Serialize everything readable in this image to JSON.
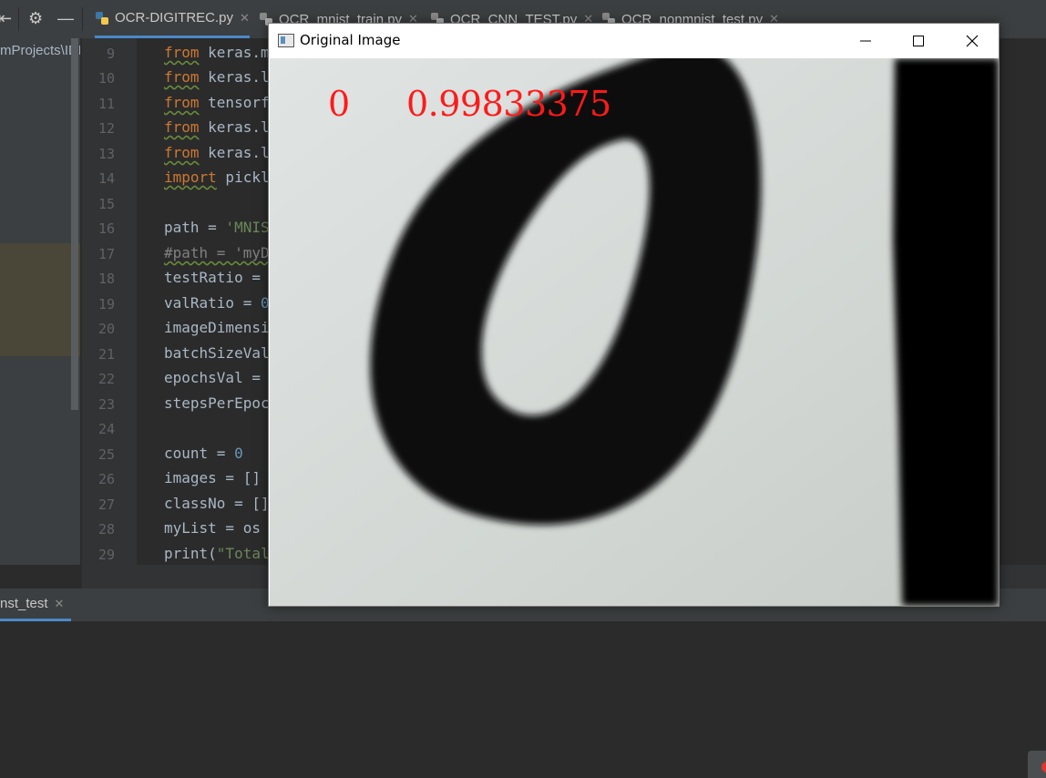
{
  "ide": {
    "tabs": [
      {
        "label": "OCR-DIGITREC.py"
      },
      {
        "label": "OCR_mnist_train.py"
      },
      {
        "label": "OCR_CNN_TEST.py"
      },
      {
        "label": "OCR_nonmnist_test.py"
      }
    ],
    "project_path_fragment": "mProjects\\IDE",
    "run_tab_label": "nst_test",
    "code_lines": [
      {
        "n": "9"
      },
      {
        "n": "10"
      },
      {
        "n": "11"
      },
      {
        "n": "12"
      },
      {
        "n": "13"
      },
      {
        "n": "14"
      },
      {
        "n": "15"
      },
      {
        "n": "16"
      },
      {
        "n": "17"
      },
      {
        "n": "18"
      },
      {
        "n": "19"
      },
      {
        "n": "20"
      },
      {
        "n": "21"
      },
      {
        "n": "22"
      },
      {
        "n": "23"
      },
      {
        "n": "24"
      },
      {
        "n": "25"
      },
      {
        "n": "26"
      },
      {
        "n": "27"
      },
      {
        "n": "28"
      },
      {
        "n": "29"
      }
    ],
    "code": {
      "l9": {
        "kw": "from",
        "rest": " keras.m"
      },
      "l10": {
        "kw": "from",
        "rest": " keras.l"
      },
      "l11": {
        "kw": "from",
        "rest": " tensorf"
      },
      "l12": {
        "kw": "from",
        "rest": " keras.l"
      },
      "l13": {
        "kw": "from",
        "rest": " keras.l"
      },
      "l14": {
        "kw": "import",
        "rest": " pickl"
      },
      "l16": {
        "a": "path = ",
        "str": "'MNIS"
      },
      "l17": {
        "cmt": "#path = 'myD"
      },
      "l18": {
        "a": "testRatio = "
      },
      "l19": {
        "a": "valRatio = ",
        "num": "0"
      },
      "l20": {
        "a": "imageDimensi"
      },
      "l21": {
        "a": "batchSizeVal"
      },
      "l22": {
        "a": "epochsVal = "
      },
      "l23": {
        "a": "stepsPerEpoc"
      },
      "l25": {
        "a": "count = ",
        "num": "0"
      },
      "l26": {
        "a": "images = []"
      },
      "l27": {
        "a": "classNo = []"
      },
      "l28": {
        "a": "myList = os"
      },
      "l29": {
        "a": "print(",
        "str": "\"Total"
      }
    }
  },
  "cv_window": {
    "title": "Original Image",
    "prediction_class": "0",
    "prediction_prob": "0.99833375"
  },
  "icons": [
    "settings-gear-icon",
    "minimize-icon",
    "python-file-icon",
    "close-icon",
    "window-minimize-icon",
    "window-maximize-icon",
    "window-close-icon"
  ],
  "colors": {
    "overlay_text": "#ff1a1a",
    "tab_underline": "#4a88c7",
    "keyword": "#cc7832",
    "string": "#6a8759"
  }
}
